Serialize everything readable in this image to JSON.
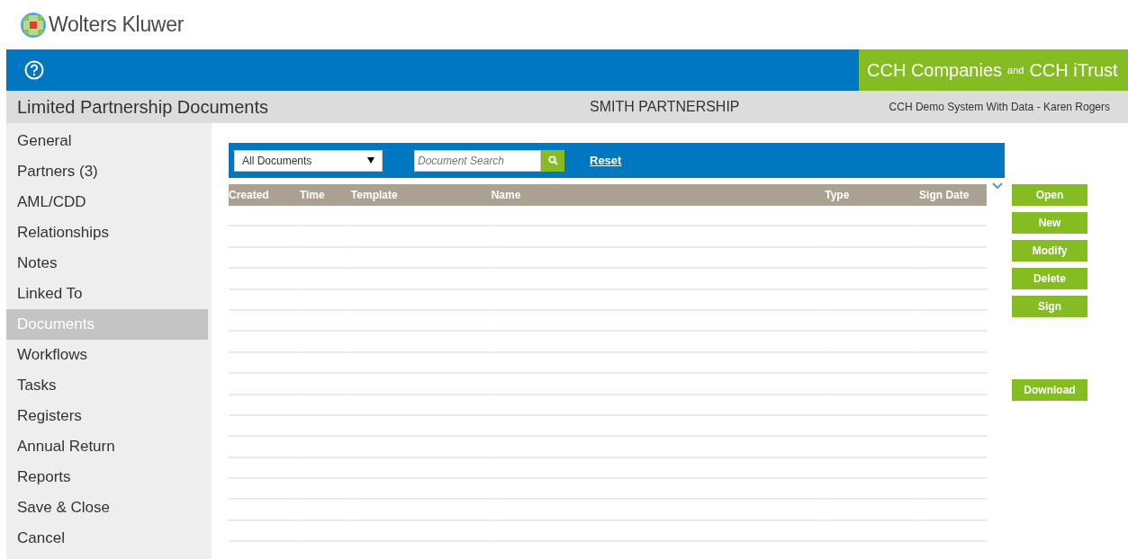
{
  "logo": {
    "text": "Wolters Kluwer"
  },
  "header": {
    "product": "CCH Companies",
    "joiner": "and",
    "product_2": "CCH iTrust"
  },
  "title_bar": {
    "title": "Limited Partnership Documents",
    "entity": "SMITH PARTNERSHIP",
    "system": "CCH Demo System With Data - Karen Rogers"
  },
  "sidebar": {
    "items": [
      {
        "label": "General",
        "selected": false
      },
      {
        "label": "Partners (3)",
        "selected": false
      },
      {
        "label": "AML/CDD",
        "selected": false
      },
      {
        "label": "Relationships",
        "selected": false
      },
      {
        "label": "Notes",
        "selected": false
      },
      {
        "label": "Linked To",
        "selected": false
      },
      {
        "label": "Documents",
        "selected": true
      },
      {
        "label": "Workflows",
        "selected": false
      },
      {
        "label": "Tasks",
        "selected": false
      },
      {
        "label": "Registers",
        "selected": false
      },
      {
        "label": "Annual Return",
        "selected": false
      },
      {
        "label": "Reports",
        "selected": false
      },
      {
        "label": "Save & Close",
        "selected": false
      },
      {
        "label": "Cancel",
        "selected": false
      }
    ]
  },
  "toolbar": {
    "filter": "All Documents",
    "search": {
      "placeholder": "Document Search"
    },
    "reset": "Reset"
  },
  "table": {
    "columns": [
      "Created",
      "Time",
      "Template",
      "Name",
      "Type",
      "Sign Date"
    ]
  },
  "actions": [
    "Open",
    "New",
    "Modify",
    "Delete",
    "Sign"
  ],
  "extra_actions": [
    "Download"
  ]
}
